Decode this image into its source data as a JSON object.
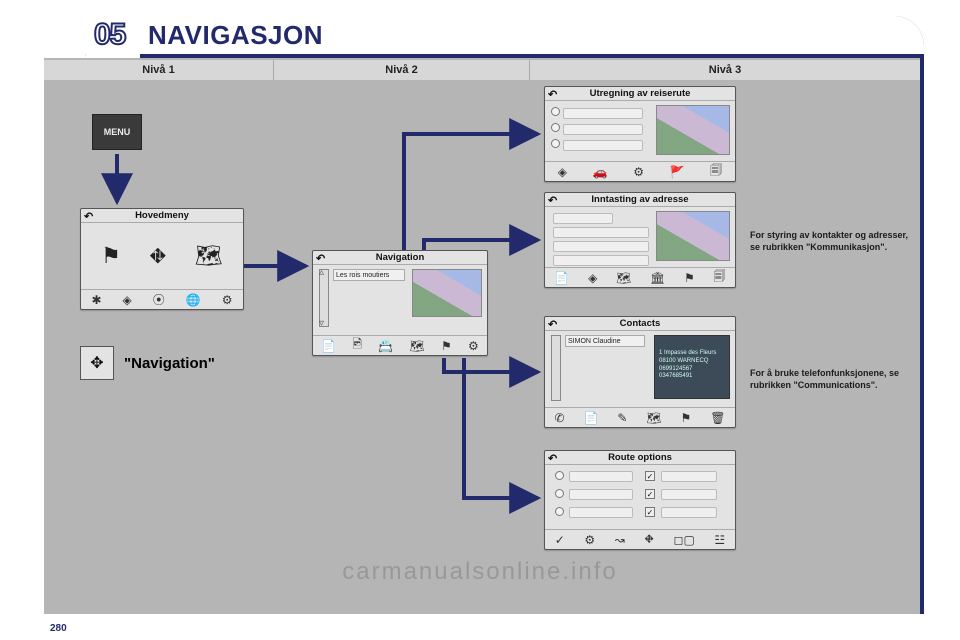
{
  "section": {
    "num": "05",
    "title": "NAVIGASJON"
  },
  "levels": {
    "l1": "Nivå 1",
    "l2": "Nivå 2",
    "l3": "Nivå 3"
  },
  "menu_button": "MENU",
  "nav_label": "\"Navigation\"",
  "panels": {
    "main": {
      "title": "Hovedmeny"
    },
    "nav": {
      "title": "Navigation",
      "list_item": "Les rois moutiers"
    },
    "route": {
      "title": "Utregning av reiserute"
    },
    "address": {
      "title": "Inntasting av adresse"
    },
    "contacts": {
      "title": "Contacts",
      "list_item": "SIMON Claudine",
      "card_lines": "1 Impasse des Fleurs\n08100 WARNECQ\n\n0699124567\n0347685491"
    },
    "options": {
      "title": "Route options"
    }
  },
  "notes": {
    "n1": "For styring av kontakter og adresser, se rubrikken \"Kommunikasjon\".",
    "n2": "For å bruke telefonfunksjonene, se rubrikken \"Communications\"."
  },
  "icons": {
    "main_body": [
      "⚑",
      "⛖",
      "🗺"
    ],
    "main_bar": [
      "✱",
      "◈",
      "⦿",
      "🌐",
      "⚙"
    ],
    "nav_bar": [
      "📄",
      "🖻",
      "📇",
      "🗺",
      "⚑",
      "⚙"
    ],
    "route_bar": [
      "◈",
      "🚗",
      "⚙",
      "🚩",
      "🗐"
    ],
    "addr_bar": [
      "📄",
      "◈",
      "🗺",
      "🏛",
      "⚑",
      "🗐"
    ],
    "contacts_bar": [
      "✆",
      "📄",
      "✎",
      "🗺",
      "⚑",
      "🗑"
    ],
    "opts_bar": [
      "✓",
      "⚙",
      "↝",
      "⛖",
      "◻▢",
      "☳"
    ]
  },
  "watermark": "carmanualsonline.info",
  "page_number": "280",
  "chart_data": null
}
